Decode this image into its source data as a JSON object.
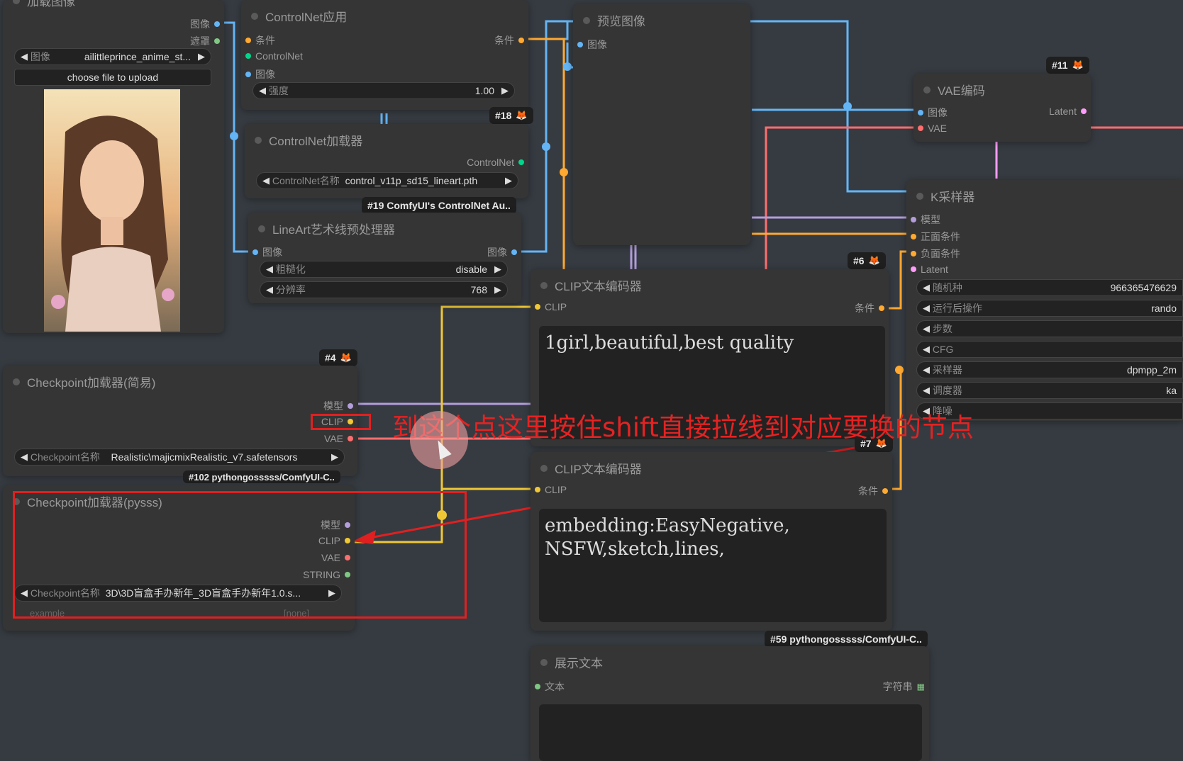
{
  "load_image": {
    "title": "加载图像",
    "out_image": "图像",
    "out_mask": "遮罩",
    "widget_label": "图像",
    "widget_value": "ailittleprince_anime_st...",
    "upload_button": "choose file to upload"
  },
  "controlnet_apply": {
    "title": "ControlNet应用",
    "in_cond": "条件",
    "in_controlnet": "ControlNet",
    "in_image": "图像",
    "out_cond": "条件",
    "strength_label": "强度",
    "strength_value": "1.00"
  },
  "controlnet_loader": {
    "badge": "#18",
    "title": "ControlNet加载器",
    "out": "ControlNet",
    "name_label": "ControlNet名称",
    "name_value": "control_v11p_sd15_lineart.pth"
  },
  "lineart": {
    "badge": "#19 ComfyUI's ControlNet Au..",
    "title": "LineArt艺术线预处理器",
    "in_image": "图像",
    "out_image": "图像",
    "coarse_label": "粗糙化",
    "coarse_value": "disable",
    "res_label": "分辨率",
    "res_value": "768"
  },
  "preview": {
    "title": "预览图像",
    "in_image": "图像"
  },
  "vae_encode": {
    "badge": "#11",
    "title": "VAE编码",
    "in_image": "图像",
    "in_vae": "VAE",
    "out_latent": "Latent"
  },
  "ksampler": {
    "title": "K采样器",
    "in_model": "模型",
    "in_pos": "正面条件",
    "in_neg": "负面条件",
    "in_latent": "Latent",
    "seed_label": "随机种",
    "seed_value": "966365476629",
    "after_label": "运行后操作",
    "after_value": "rando",
    "steps_label": "步数",
    "cfg_label": "CFG",
    "sampler_label": "采样器",
    "sampler_value": "dpmpp_2m",
    "scheduler_label": "调度器",
    "scheduler_value": "ka",
    "denoise_label": "降噪"
  },
  "clip_pos": {
    "badge": "#6",
    "title": "CLIP文本编码器",
    "in_clip": "CLIP",
    "out_cond": "条件",
    "text": "1girl,beautiful,best quality"
  },
  "clip_neg": {
    "badge": "#7",
    "title": "CLIP文本编码器",
    "in_clip": "CLIP",
    "out_cond": "条件",
    "text": "embedding:EasyNegative,\nNSFW,sketch,lines,"
  },
  "ckpt_simple": {
    "badge": "#4",
    "title": "Checkpoint加载器(简易)",
    "out_model": "模型",
    "out_clip": "CLIP",
    "out_vae": "VAE",
    "name_label": "Checkpoint名称",
    "name_value": "Realistic\\majicmixRealistic_v7.safetensors",
    "footer": "#102 pythongosssss/ComfyUI-C.."
  },
  "ckpt_pysss": {
    "title": "Checkpoint加载器(pysss)",
    "out_model": "模型",
    "out_clip": "CLIP",
    "out_vae": "VAE",
    "out_string": "STRING",
    "name_label": "Checkpoint名称",
    "name_value": "3D\\3D盲盒手办新年_3D盲盒手办新年1.0.s...",
    "example_label": "example",
    "example_value": "[none]"
  },
  "show_text": {
    "badge": "#59 pythongosssss/ComfyUI-C..",
    "title": "展示文本",
    "in_text": "文本",
    "out_string": "字符串"
  },
  "annotation": {
    "text": "到这个点这里按住shift直接拉线到对应要换的节点"
  },
  "colors": {
    "clip": "#f0c836",
    "vae": "#ff6e6e",
    "image": "#64b5f6",
    "model": "#b39ddb",
    "cond": "#ffa931",
    "latent": "#ff9cf9",
    "annotation": "#e02020"
  }
}
